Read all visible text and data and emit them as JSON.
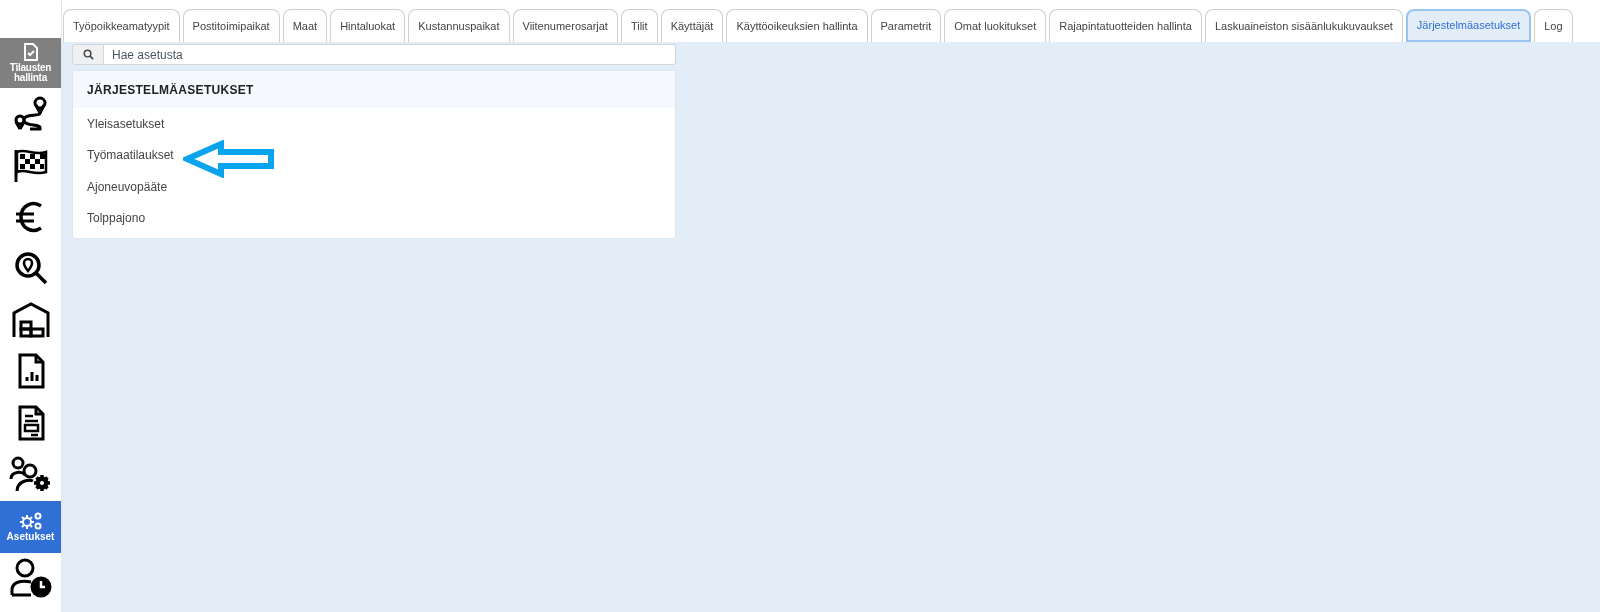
{
  "sidebar": {
    "module_button": {
      "label": "Tilausten hallinta"
    },
    "items": [
      {
        "selected": false
      },
      {
        "selected": false
      },
      {
        "selected": false
      },
      {
        "selected": false
      },
      {
        "selected": false
      },
      {
        "selected": false
      },
      {
        "selected": false
      },
      {
        "selected": false
      },
      {
        "label": "Asetukset",
        "selected": true
      },
      {
        "selected": false
      }
    ]
  },
  "tabs": [
    {
      "label": "Työpoikkeamatyypit",
      "selected": false
    },
    {
      "label": "Postitoimipaikat",
      "selected": false
    },
    {
      "label": "Maat",
      "selected": false
    },
    {
      "label": "Hintaluokat",
      "selected": false
    },
    {
      "label": "Kustannuspaikat",
      "selected": false
    },
    {
      "label": "Viitenumerosarjat",
      "selected": false
    },
    {
      "label": "Tilit",
      "selected": false
    },
    {
      "label": "Käyttäjät",
      "selected": false
    },
    {
      "label": "Käyttöoikeuksien hallinta",
      "selected": false
    },
    {
      "label": "Parametrit",
      "selected": false
    },
    {
      "label": "Omat luokitukset",
      "selected": false
    },
    {
      "label": "Rajapintatuotteiden hallinta",
      "selected": false
    },
    {
      "label": "Laskuaineiston sisäänlukukuvaukset",
      "selected": false
    },
    {
      "label": "Järjestelmäasetukset",
      "selected": true
    },
    {
      "label": "Log",
      "selected": false
    }
  ],
  "search": {
    "placeholder": "Hae asetusta"
  },
  "panel": {
    "title": "JÄRJESTELMÄASETUKSET",
    "items": [
      {
        "label": "Yleisasetukset"
      },
      {
        "label": "Työmaatilaukset"
      },
      {
        "label": "Ajoneuvopääte"
      },
      {
        "label": "Tolppajono"
      }
    ]
  }
}
